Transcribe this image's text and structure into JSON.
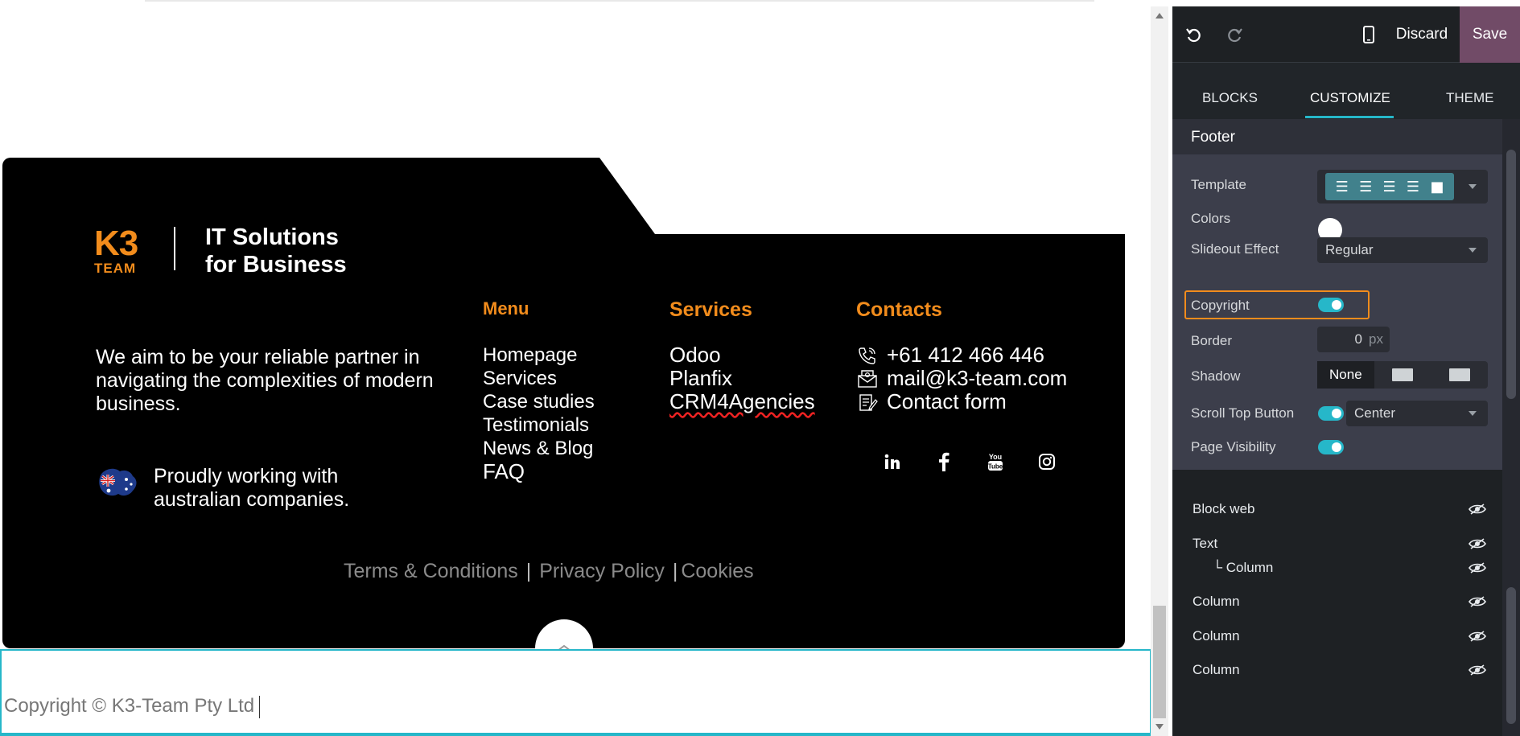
{
  "site": {
    "logo": {
      "k3": "K3",
      "team": "TEAM"
    },
    "tagline": [
      "IT Solutions",
      "for Business"
    ],
    "about": "We aim to be your reliable partner in navigating the complexities of modern business.",
    "australia": "Proudly working with australian companies.",
    "menu": {
      "title": "Menu",
      "items": [
        "Homepage",
        "Services",
        "Case studies",
        "Testimonials",
        "News & Blog",
        "FAQ"
      ]
    },
    "services": {
      "title": "Services",
      "items": [
        "Odoo",
        "Planfix",
        "CRM4Agencies"
      ]
    },
    "contacts": {
      "title": "Contacts",
      "phone": "+61 412 466 446",
      "email": "mail@k3-team.com",
      "form": "Contact form"
    },
    "socials": [
      "in",
      "f",
      "You Tube",
      "instagram"
    ],
    "legal": {
      "terms": "Terms & Conditions",
      "sep1": "|",
      "privacy": "Privacy Policy",
      "sep2": "|",
      "cookies": "Cookies"
    },
    "copyright": "Copyright © K3-Team Pty Ltd"
  },
  "editor": {
    "toolbar": {
      "discard": "Discard",
      "save": "Save"
    },
    "tabs": [
      "BLOCKS",
      "CUSTOMIZE",
      "THEME"
    ],
    "active_tab": "CUSTOMIZE",
    "section_title": "Footer",
    "options": {
      "template": "Template",
      "colors": "Colors",
      "slideout": "Slideout Effect",
      "slideout_value": "Regular",
      "copyright": "Copyright",
      "border": "Border",
      "border_value": "0",
      "border_unit": "px",
      "shadow": "Shadow",
      "shadow_value": "None",
      "scroll_top": "Scroll Top Button",
      "scroll_top_value": "Center",
      "visibility": "Page Visibility"
    },
    "layers": [
      "Block web",
      "Text",
      "└ Column",
      "Column",
      "Column",
      "Column"
    ],
    "accent": "#26b7c9",
    "brand": "#714b67",
    "highlight": "#f28c1c"
  }
}
